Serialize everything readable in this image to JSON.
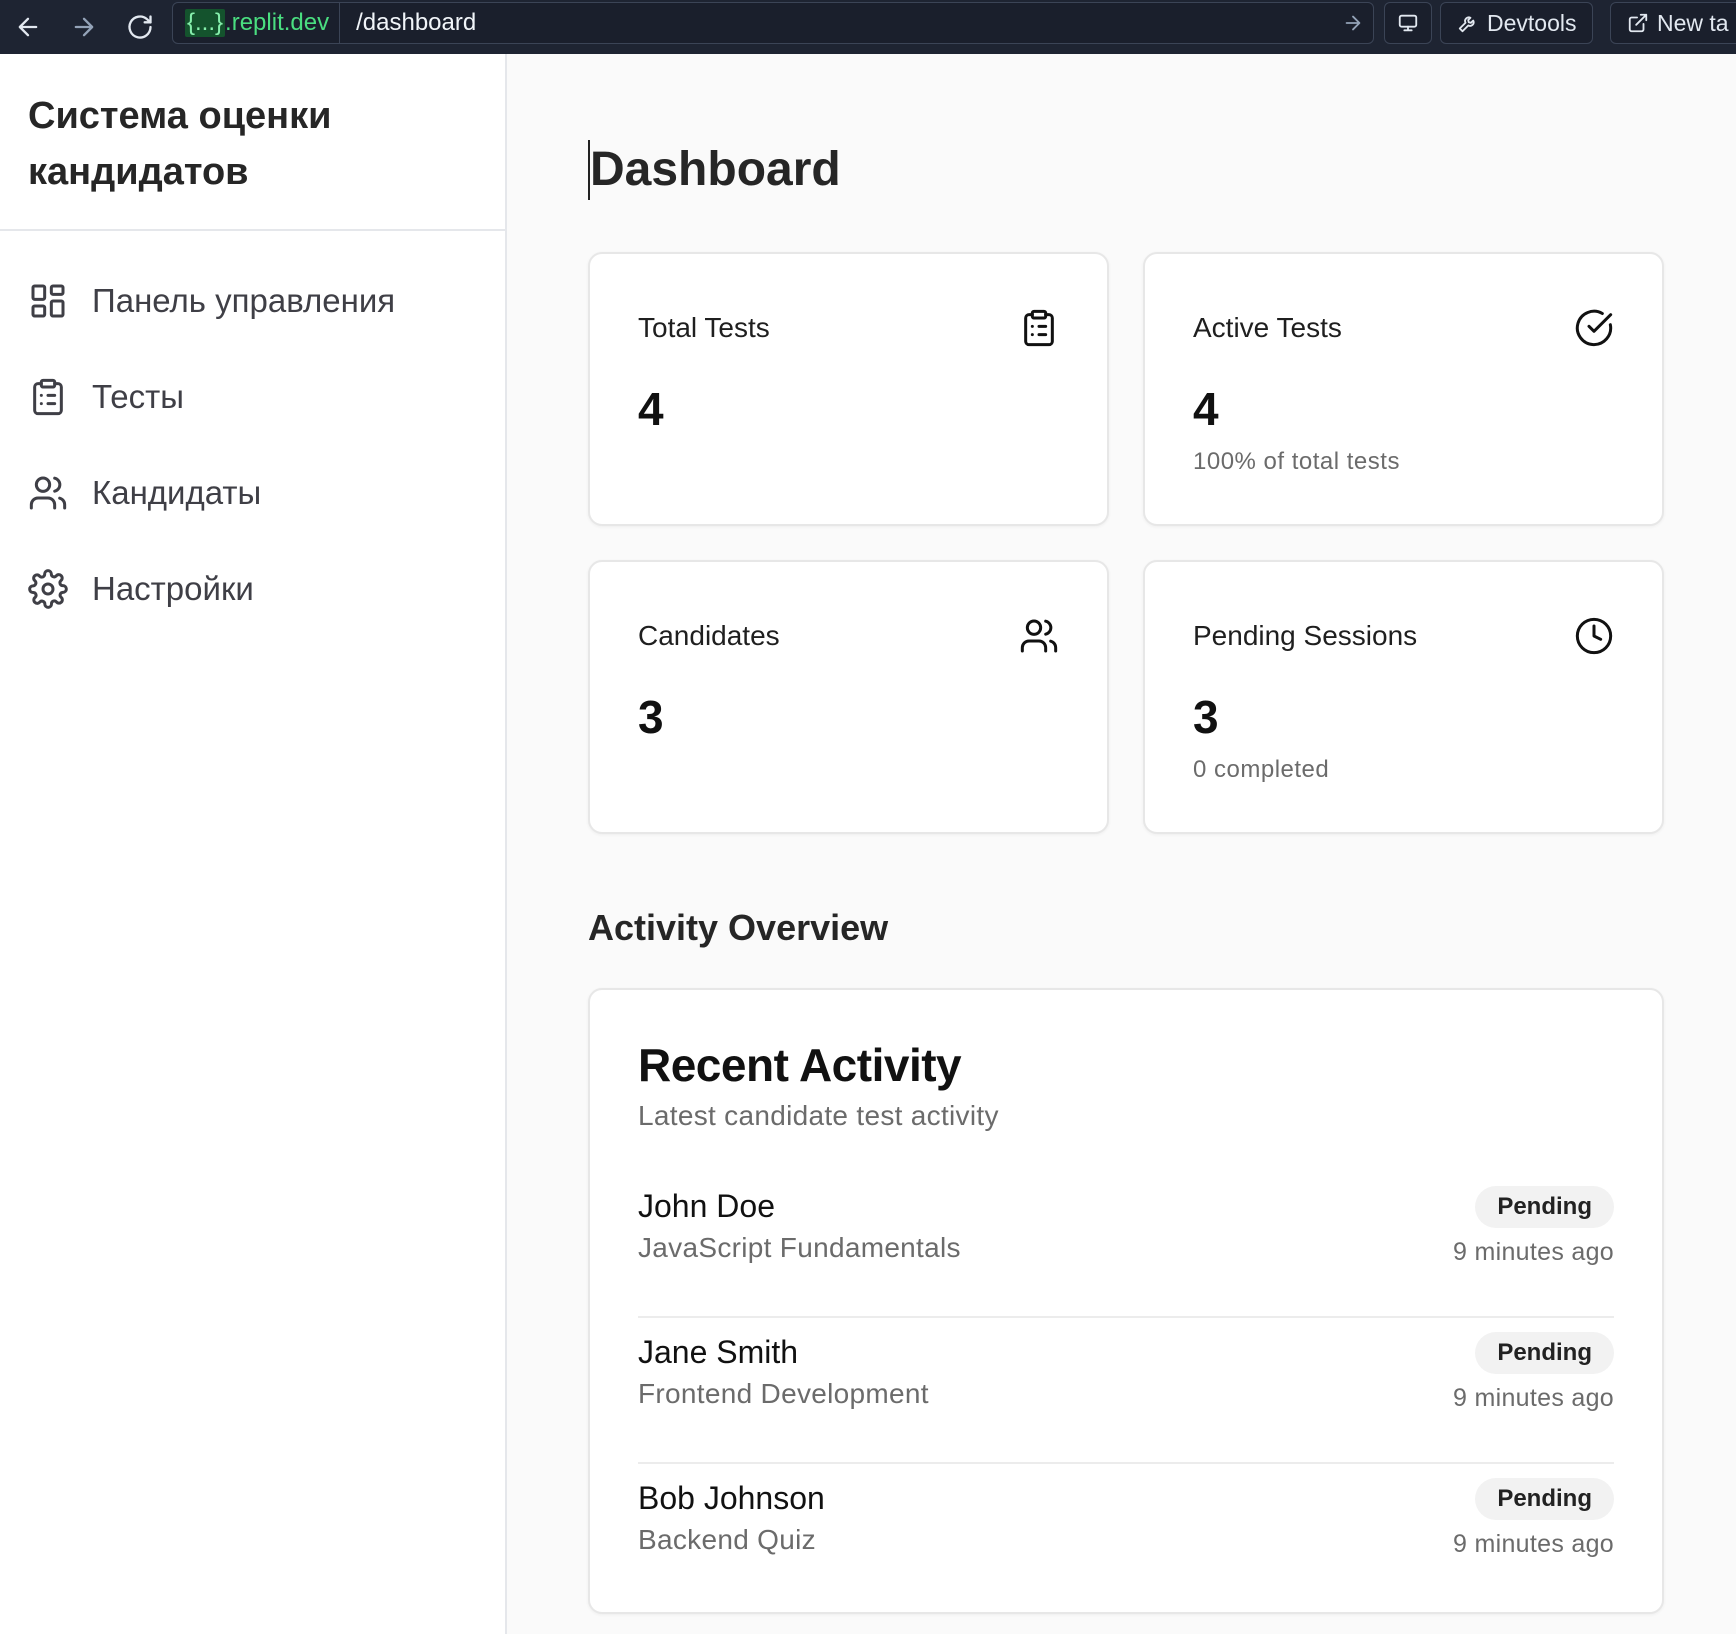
{
  "browser": {
    "url_domain_brace": "{...}",
    "url_domain_rest": ".replit.dev",
    "url_path": "/dashboard",
    "devtools_label": "Devtools",
    "new_tab_label": "New ta"
  },
  "sidebar": {
    "brand": "Система оценки кандидатов",
    "items": [
      {
        "label": "Панель управления",
        "icon": "grid-icon"
      },
      {
        "label": "Тесты",
        "icon": "clipboard-icon"
      },
      {
        "label": "Кандидаты",
        "icon": "users-icon"
      },
      {
        "label": "Настройки",
        "icon": "gear-icon"
      }
    ]
  },
  "main": {
    "title": "Dashboard",
    "cards": [
      {
        "title": "Total Tests",
        "value": "4",
        "sub": "",
        "icon": "clipboard-icon"
      },
      {
        "title": "Active Tests",
        "value": "4",
        "sub": "100% of total tests",
        "icon": "check-circle-icon"
      },
      {
        "title": "Candidates",
        "value": "3",
        "sub": "",
        "icon": "users-icon"
      },
      {
        "title": "Pending Sessions",
        "value": "3",
        "sub": "0 completed",
        "icon": "clock-icon"
      }
    ],
    "section_title": "Activity Overview",
    "activity": {
      "title": "Recent Activity",
      "subtitle": "Latest candidate test activity",
      "rows": [
        {
          "name": "John Doe",
          "test": "JavaScript Fundamentals",
          "status": "Pending",
          "time": "9 minutes ago"
        },
        {
          "name": "Jane Smith",
          "test": "Frontend Development",
          "status": "Pending",
          "time": "9 minutes ago"
        },
        {
          "name": "Bob Johnson",
          "test": "Backend Quiz",
          "status": "Pending",
          "time": "9 minutes ago"
        }
      ]
    }
  }
}
